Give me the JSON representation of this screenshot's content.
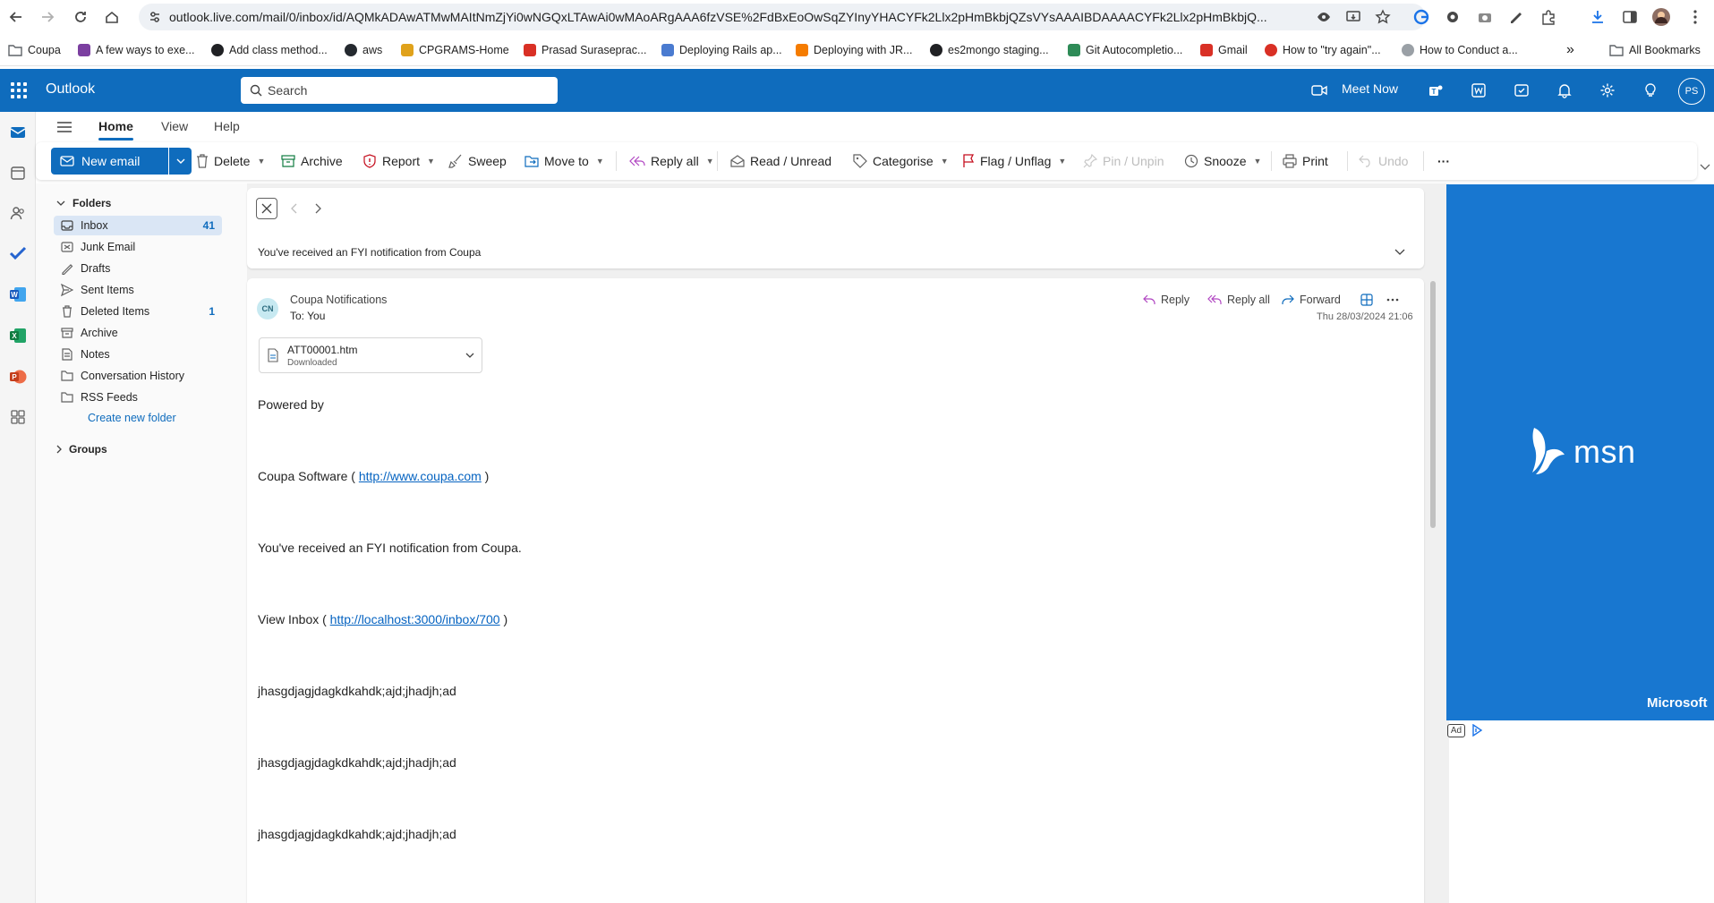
{
  "browser": {
    "url": "outlook.live.com/mail/0/inbox/id/AQMkADAwATMwMAItNmZjYi0wNGQxLTAwAi0wMAoARgAAA6fzVSE%2FdBxEoOwSqZYInyYHACYFk2Llx2pHmBkbjQZsVYsAAAIBDAAAACYFk2Llx2pHmBkbjQ...",
    "bookmarks": [
      {
        "label": "Coupa",
        "color": "#5f6368"
      },
      {
        "label": "A few ways to exe...",
        "color": "#7b3fa0"
      },
      {
        "label": "Add class method...",
        "color": "#202124"
      },
      {
        "label": "aws",
        "color": "#24292f"
      },
      {
        "label": "CPGRAMS-Home",
        "color": "#e0a21b"
      },
      {
        "label": "Prasad Suraseprас...",
        "color": "#d93025"
      },
      {
        "label": "Deploying Rails ap...",
        "color": "#4a7bd0"
      },
      {
        "label": "Deploying with JR...",
        "color": "#f57c00"
      },
      {
        "label": "es2mongo staging...",
        "color": "#202124"
      },
      {
        "label": "Git Autocompletio...",
        "color": "#2e8b57"
      },
      {
        "label": "Gmail",
        "color": "#d93025"
      },
      {
        "label": "How to \"try again\"...",
        "color": "#d93025"
      },
      {
        "label": "How to Conduct a...",
        "color": "#9aa0a6"
      }
    ],
    "more_bookmarks": "»",
    "all_bookmarks": "All Bookmarks"
  },
  "header": {
    "app_name": "Outlook",
    "search_placeholder": "Search",
    "meet_now": "Meet Now",
    "avatar_initials": "PS",
    "brand_color": "#0f6cbd"
  },
  "tabs": [
    {
      "label": "Home",
      "active": true
    },
    {
      "label": "View",
      "active": false
    },
    {
      "label": "Help",
      "active": false
    }
  ],
  "ribbon": {
    "new_email": "New email",
    "delete": "Delete",
    "archive": "Archive",
    "report": "Report",
    "sweep": "Sweep",
    "move_to": "Move to",
    "reply_all": "Reply all",
    "read_unread": "Read / Unread",
    "categorise": "Categorise",
    "flag_unflag": "Flag / Unflag",
    "pin_unpin": "Pin / Unpin",
    "snooze": "Snooze",
    "print": "Print",
    "undo": "Undo",
    "more": "···"
  },
  "folders": {
    "heading": "Folders",
    "items": [
      {
        "label": "Inbox",
        "count": "41",
        "selected": true,
        "icon": "inbox-icon"
      },
      {
        "label": "Junk Email",
        "count": "",
        "selected": false,
        "icon": "junk-icon"
      },
      {
        "label": "Drafts",
        "count": "",
        "selected": false,
        "icon": "drafts-icon"
      },
      {
        "label": "Sent Items",
        "count": "",
        "selected": false,
        "icon": "sent-icon"
      },
      {
        "label": "Deleted Items",
        "count": "1",
        "selected": false,
        "icon": "trash-icon"
      },
      {
        "label": "Archive",
        "count": "",
        "selected": false,
        "icon": "archive-icon"
      },
      {
        "label": "Notes",
        "count": "",
        "selected": false,
        "icon": "notes-icon"
      },
      {
        "label": "Conversation History",
        "count": "",
        "selected": false,
        "icon": "folder-icon"
      },
      {
        "label": "RSS Feeds",
        "count": "",
        "selected": false,
        "icon": "folder-icon"
      }
    ],
    "create_new": "Create new folder",
    "groups": "Groups"
  },
  "message": {
    "subject": "You've received an FYI notification from Coupa",
    "sender_initials": "CN",
    "sender": "Coupa Notifications",
    "to_label": "To:",
    "to_value": "You",
    "date": "Thu 28/03/2024 21:06",
    "actions": {
      "reply": "Reply",
      "reply_all": "Reply all",
      "forward": "Forward"
    },
    "attachment": {
      "name": "ATT00001.htm",
      "status": "Downloaded"
    },
    "body": {
      "powered_by": "Powered by",
      "coupa_prefix": "Coupa Software ( ",
      "coupa_link": "http://www.coupa.com",
      "coupa_suffix": " )",
      "fyi": "You've received an FYI notification from Coupa.",
      "inbox_prefix": "View Inbox ( ",
      "inbox_link": "http://localhost:3000/inbox/700",
      "inbox_suffix": " )",
      "gibberish_1": "jhasgdjagjdagkdkahdk;ajd;jhadjh;ad",
      "gibberish_2": "jhasgdjagjdagkdkahdk;ajd;jhadjh;ad",
      "gibberish_3": "jhasgdjagjdagkdkahdk;ajd;jhadjh;ad"
    }
  },
  "ad": {
    "logo_text": "msn",
    "vendor": "Microsoft",
    "badge": "Ad",
    "background": "#1877d0"
  }
}
